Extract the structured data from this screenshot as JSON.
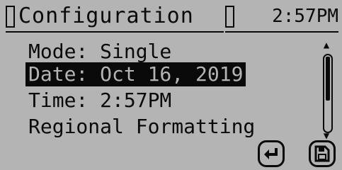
{
  "header": {
    "title": "Configuration",
    "time": "2:57PM"
  },
  "menu": {
    "items": [
      {
        "label": "Mode: Single",
        "selected": false
      },
      {
        "label": "Date: Oct 16, 2019",
        "selected": true
      },
      {
        "label": "Time: 2:57PM",
        "selected": false
      },
      {
        "label": "Regional Formatting",
        "selected": false
      }
    ]
  },
  "scrollbar": {
    "position": 0.0,
    "visible_fraction": 0.6
  },
  "footer": {
    "buttons": [
      {
        "icon": "enter-icon"
      },
      {
        "icon": "save-icon"
      }
    ]
  },
  "colors": {
    "background": "#b4b4b4",
    "foreground": "#0a0a0a"
  }
}
